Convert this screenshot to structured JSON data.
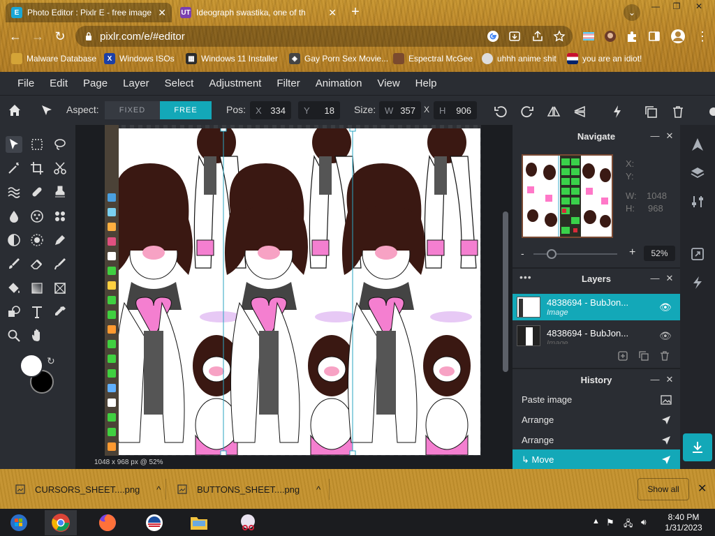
{
  "browser": {
    "tabs": [
      {
        "title": "Photo Editor : Pixlr E - free image",
        "favicon": "pixlr-favicon",
        "active": true
      },
      {
        "title": "Ideograph swastika, one of th",
        "favicon": "ut-favicon",
        "active": false
      }
    ],
    "new_tab": "+",
    "url": "pixlr.com/e/#editor",
    "bookmarks": [
      {
        "label": "Malware Database",
        "icon": "folder-icon"
      },
      {
        "label": "Windows ISOs",
        "icon": "x-icon"
      },
      {
        "label": "Windows 11 Installer",
        "icon": "windows-icon"
      },
      {
        "label": "Gay Porn Sex Movie...",
        "icon": "cube-icon"
      },
      {
        "label": "Espectral McGee",
        "icon": "face-icon"
      },
      {
        "label": "uhhh anime shit",
        "icon": "anime-icon"
      },
      {
        "label": "you are an idiot!",
        "icon": "flag-icon"
      }
    ]
  },
  "menu": [
    "File",
    "Edit",
    "Page",
    "Layer",
    "Select",
    "Adjustment",
    "Filter",
    "Animation",
    "View",
    "Help"
  ],
  "toolbar": {
    "aspect_label": "Aspect:",
    "fixed": "FIXED",
    "free": "FREE",
    "pos_label": "Pos:",
    "x_key": "X",
    "x_val": "334",
    "y_key": "Y",
    "y_val": "18",
    "size_label": "Size:",
    "w_key": "W",
    "w_val": "357",
    "times": "X",
    "h_key": "H",
    "h_val": "906"
  },
  "canvas": {
    "status": "1048 x 968 px @ 52%"
  },
  "navigate": {
    "title": "Navigate",
    "x_label": "X:",
    "y_label": "Y:",
    "w_label": "W:",
    "w_val": "1048",
    "h_label": "H:",
    "h_val": "968",
    "zoom": "52%",
    "zoom_level": 0.22
  },
  "layers": {
    "title": "Layers",
    "items": [
      {
        "name": "4838694 - BubJon...",
        "type": "Image",
        "selected": true
      },
      {
        "name": "4838694 - BubJon...",
        "type": "Image",
        "selected": false
      }
    ]
  },
  "history": {
    "title": "History",
    "items": [
      {
        "label": "Paste image",
        "icon": "image-icon"
      },
      {
        "label": "Arrange",
        "icon": "arrow-icon"
      },
      {
        "label": "Arrange",
        "icon": "arrow-icon"
      },
      {
        "label": "↳ Move",
        "icon": "arrow-icon",
        "selected": true
      }
    ]
  },
  "downloads": {
    "items": [
      {
        "name": "CURSORS_SHEET....png"
      },
      {
        "name": "BUTTONS_SHEET....png"
      }
    ],
    "show_all": "Show all"
  },
  "taskbar": {
    "time": "8:40 PM",
    "date": "1/31/2023"
  },
  "colors": {
    "accent": "#13a8b8",
    "app_bg": "#2a2d33",
    "chrome_bg": "#c18b2a"
  }
}
